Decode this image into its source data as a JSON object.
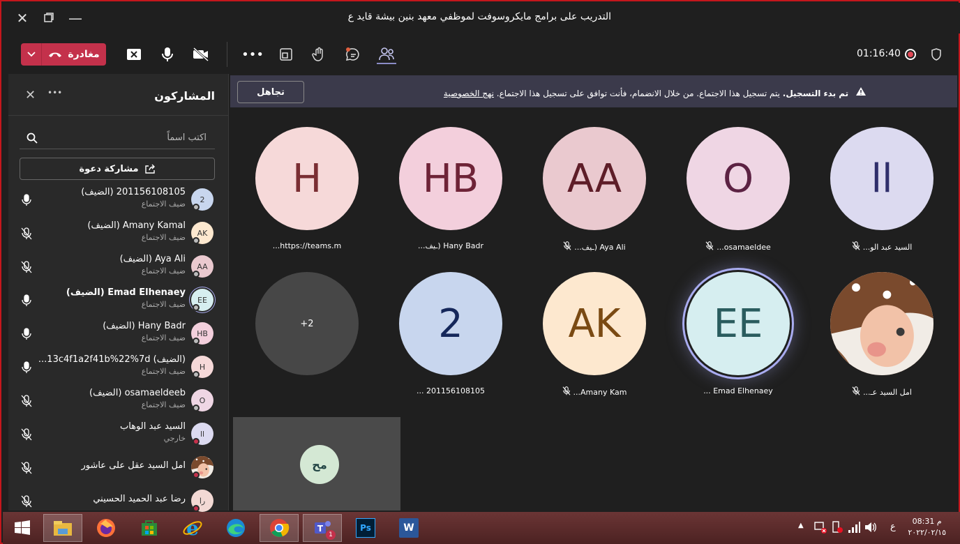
{
  "window": {
    "title": "التدريب على برامج مايكروسوفت لموظفي معهد بنين بيشة قايد ع"
  },
  "toolbar": {
    "leave_label": "مغادرة",
    "timer": "01:16:40"
  },
  "sidebar": {
    "title": "المشاركون",
    "search_placeholder": "اكتب اسماً",
    "invite_label": "مشاركة دعوة",
    "participants": [
      {
        "name": "201156108105 (الضيف)",
        "role": "ضيف الاجتماع",
        "initials": "2",
        "color": "#c8d6ee",
        "status": "#bbbbbb",
        "muted": false
      },
      {
        "name": "Amany Kamal (الضيف)",
        "role": "ضيف الاجتماع",
        "initials": "AK",
        "color": "#fde8cf",
        "status": "#bbbbbb",
        "muted": true
      },
      {
        "name": "Aya Ali (الضيف)",
        "role": "ضيف الاجتماع",
        "initials": "AA",
        "color": "#eac9cf",
        "status": "#bbbbbb",
        "muted": true
      },
      {
        "name": "Emad Elhenaey (الضيف)",
        "role": "ضيف الاجتماع",
        "initials": "EE",
        "color": "#d6eef0",
        "status": "#bbbbbb",
        "muted": false
      },
      {
        "name": "Hany Badr (الضيف)",
        "role": "ضيف الاجتماع",
        "initials": "HB",
        "color": "#f3cfdc",
        "status": "#bbbbbb",
        "muted": false
      },
      {
        "name": "(الضيف) 13c4f1a2f41b%22%7d...",
        "role": "ضيف الاجتماع",
        "initials": "H",
        "color": "#f6d9d9",
        "status": "#bbbbbb",
        "muted": false
      },
      {
        "name": "osamaeldeeb (الضيف)",
        "role": "ضيف الاجتماع",
        "initials": "O",
        "color": "#efd6e4",
        "status": "#bbbbbb",
        "muted": true
      },
      {
        "name": "السيد عبد الوهاب",
        "role": "خارجي",
        "initials": "ll",
        "color": "#dcdaf0",
        "status": "#c4314b",
        "muted": true
      },
      {
        "name": "امل السيد عقل على عاشور",
        "role": "",
        "initials": "",
        "color": "#b07a56",
        "status": "#c4314b",
        "muted": true
      },
      {
        "name": "رضا عبد الحميد الحسيني",
        "role": "",
        "initials": "را",
        "color": "#f3d9d4",
        "status": "#c4314b",
        "muted": true
      }
    ]
  },
  "banner": {
    "bold": "تم بدء التسجيل.",
    "text": "يتم تسجيل هذا الاجتماع. من خلال الانضمام، فأنت توافق على تسجيل هذا الاجتماع.",
    "link": "نهج الخصوصية",
    "dismiss_label": "تجاهل"
  },
  "tiles": [
    {
      "initials": "H",
      "name": "https://teams.m...",
      "bg": "#f6d9d9",
      "fg": "#7a2e33",
      "muted": false
    },
    {
      "initials": "HB",
      "name": "Hany Badr (ـيف...",
      "bg": "#f3cfdc",
      "fg": "#6e2337",
      "muted": false
    },
    {
      "initials": "AA",
      "name": "Aya Ali (ـيف...",
      "bg": "#eac9cf",
      "fg": "#5e1d28",
      "muted": true
    },
    {
      "initials": "O",
      "name": "osamaeldee...",
      "bg": "#efd6e4",
      "fg": "#5c2243",
      "muted": true
    },
    {
      "initials": "ll",
      "name": "السيد عبد الو...",
      "bg": "#dcdaf0",
      "fg": "#2f2e6b",
      "muted": true
    },
    {
      "initials": "+2",
      "name": "",
      "bg": "#474747",
      "fg": "#ffffff",
      "muted": false
    },
    {
      "initials": "2",
      "name": "201156108105 ...",
      "bg": "#c8d6ee",
      "fg": "#15275a",
      "muted": false
    },
    {
      "initials": "AK",
      "name": "Amany Kam...",
      "bg": "#fde8cf",
      "fg": "#7a4a13",
      "muted": true
    },
    {
      "initials": "EE",
      "name": "Emad Elhenaey ...",
      "bg": "#d6eef0",
      "fg": "#2a5c5e",
      "muted": false
    },
    {
      "initials": "",
      "name": "امل السيد عـ...",
      "bg": "#b07a56",
      "fg": "#ffffff",
      "muted": true
    }
  ],
  "self_view": {
    "initials": "مح"
  },
  "taskbar": {
    "apps": [
      "file-explorer",
      "firefox",
      "store",
      "internet-explorer",
      "edge",
      "chrome",
      "teams",
      "photoshop",
      "word"
    ],
    "teams_badge": "1",
    "ps_label": "Ps",
    "word_label": "W",
    "lang": "ع",
    "time": "08:31 م",
    "date": "٢٠٢٢/٠٢/١٥"
  }
}
